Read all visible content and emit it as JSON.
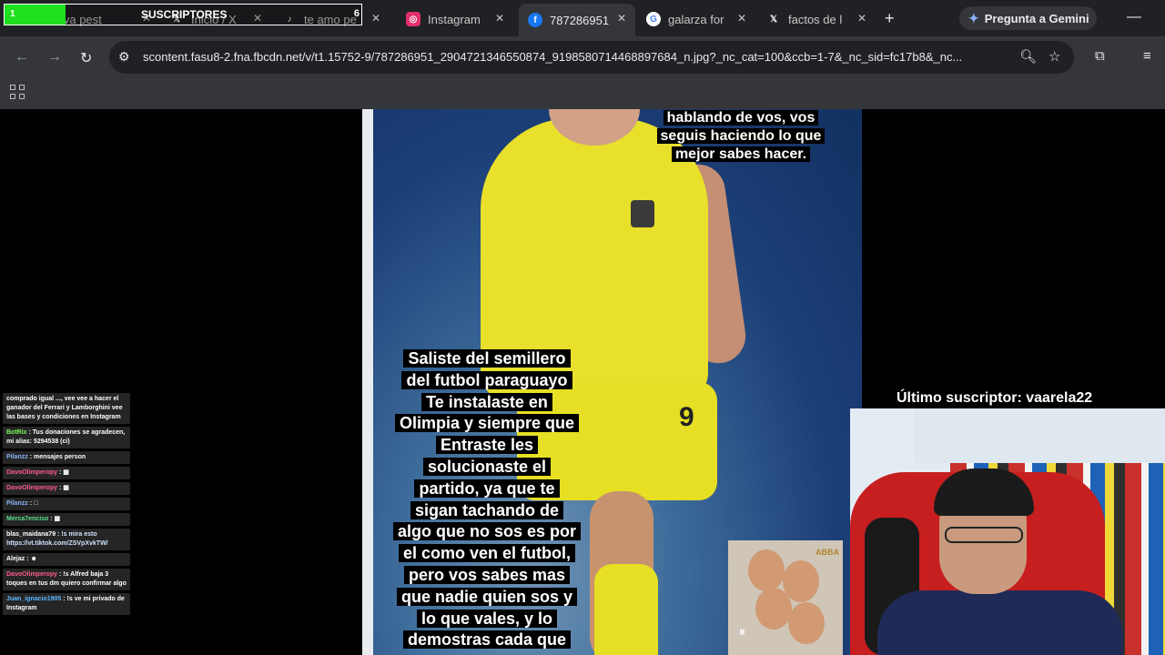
{
  "tabs": [
    {
      "label": "Nueva pest",
      "icon": "newtab-icon",
      "color": "#8ab4f8"
    },
    {
      "label": "Inicio / X",
      "icon": "x-icon",
      "color": "#ffffff"
    },
    {
      "label": "te amo pe",
      "icon": "tiktok-icon",
      "color": "#ffffff"
    },
    {
      "label": "Instagram",
      "icon": "instagram-icon",
      "color": "#e1306c"
    },
    {
      "label": "787286951",
      "icon": "facebook-icon",
      "color": "#1877f2",
      "active": true
    },
    {
      "label": "galarza for",
      "icon": "google-icon",
      "color": "#ffffff"
    },
    {
      "label": "factos de l",
      "icon": "x-icon",
      "color": "#ffffff"
    }
  ],
  "gemini_label": "Pregunta a Gemini",
  "subs_widget": {
    "current": "1",
    "title": "SUSCRIPTORES",
    "goal": "6",
    "progress": 0.17
  },
  "address": {
    "url": "scontent.fasu8-2.fna.fbcdn.net/v/t1.15752-9/787286951_2904721346550874_9198580714468897684_n.jpg?_nc_cat=100&ccb=1-7&_nc_sid=fc17b8&_nc..."
  },
  "photo": {
    "caption_top": [
      "hablando de vos, vos",
      "seguis haciendo lo que",
      "mejor sabes hacer."
    ],
    "caption_main": [
      "Saliste del semillero",
      "del futbol paraguayo",
      "Te instalaste en",
      "Olimpia y siempre que",
      "Entraste les",
      "solucionaste el",
      "partido, ya que te",
      "sigan tachando de",
      "algo que no sos es por",
      "el como ven el futbol,",
      "pero vos sabes mas",
      "que nadie quien sos y",
      "lo que vales, y lo",
      "demostras cada que"
    ],
    "jersey_number": "9",
    "album_brand": "ABBA"
  },
  "chat": [
    {
      "user": "",
      "text": "comprado igual ..., vee vee a hacer el ganador del Ferrari y Lamborghini vee las bases y condiciones en Instagram",
      "color": "#ffffff"
    },
    {
      "user": "BotRix",
      "text": ": Tus donaciones se agradecen, mi alias: 5294538 (ci)",
      "color": "#7cfc5c"
    },
    {
      "user": "Pilanzz",
      "text": ": mensajes person",
      "color": "#8ab4f8"
    },
    {
      "user": "DavoOlimperopy",
      "text": ": ▦",
      "color": "#ff5c8a"
    },
    {
      "user": "DavoOlimperopy",
      "text": ": ▦",
      "color": "#ff5c8a"
    },
    {
      "user": "Pilanzz",
      "text": ": □",
      "color": "#8ab4f8"
    },
    {
      "user": "Merca7enciso",
      "text": ": ▦",
      "color": "#5ce08a"
    },
    {
      "user": "blas_maidana79",
      "text": ": !s mira esto https://vt.tiktok.com/ZSVpXvkTW/",
      "color": "#ffffff"
    },
    {
      "user": "Alejaz",
      "text": ": ☻",
      "color": "#ffffff"
    },
    {
      "user": "DavoOlimperopy",
      "text": ": !s Alfred baja 3 toques en tus dm quiero confirmar algo",
      "color": "#ff5c8a"
    },
    {
      "user": "Juan_ignacio1905",
      "text": ": !s ve mi privado de Instagram",
      "color": "#5cb8ff"
    }
  ],
  "last_subscriber": "Último suscriptor: vaarela22",
  "colors": {
    "tab_bg": "#202124",
    "toolbar_bg": "#35363a",
    "accent": "#8ab4f8"
  }
}
